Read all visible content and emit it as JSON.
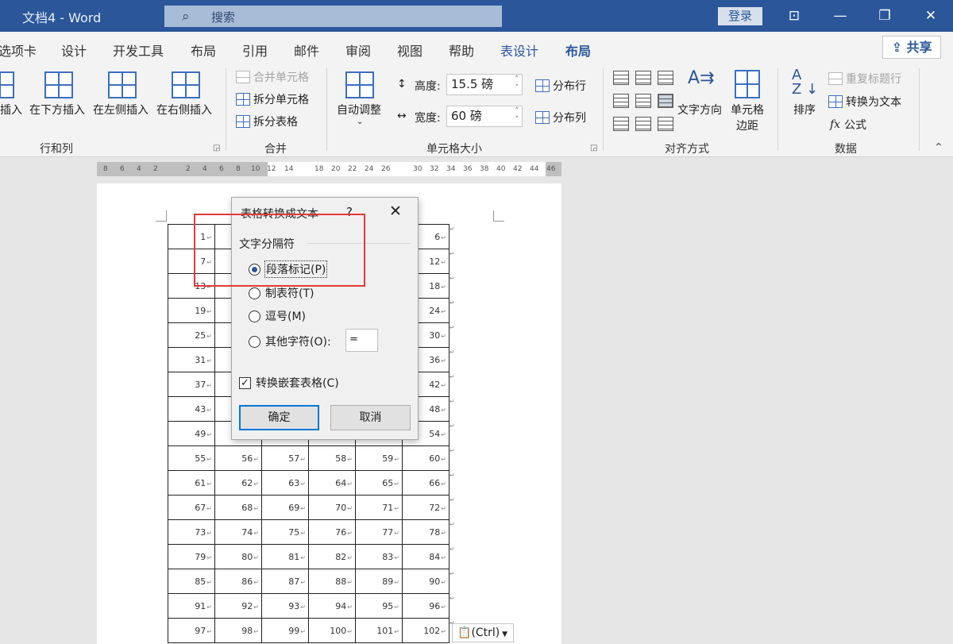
{
  "titlebar": {
    "title": "文档4  -  Word",
    "search_placeholder": "搜索",
    "login": "登录"
  },
  "tabs": [
    {
      "label": "选项卡"
    },
    {
      "label": "设计"
    },
    {
      "label": "开发工具"
    },
    {
      "label": "布局"
    },
    {
      "label": "引用"
    },
    {
      "label": "邮件"
    },
    {
      "label": "审阅"
    },
    {
      "label": "视图"
    },
    {
      "label": "帮助"
    },
    {
      "label": "表设计"
    },
    {
      "label": "布局"
    }
  ],
  "share": "共享",
  "ribbon": {
    "rows_cols": {
      "insert": "插入",
      "insert_below": "在下方插入",
      "insert_left": "在左侧插入",
      "insert_right": "在右侧插入",
      "label": "行和列"
    },
    "merge": {
      "merge_cells": "合并单元格",
      "split_cells": "拆分单元格",
      "split_table": "拆分表格",
      "label": "合并"
    },
    "cell_size": {
      "autofit": "自动调整",
      "height_label": "高度:",
      "height_value": "15.5 磅",
      "width_label": "宽度:",
      "width_value": "60 磅",
      "dist_rows": "分布行",
      "dist_cols": "分布列",
      "label": "单元格大小"
    },
    "alignment": {
      "text_direction": "文字方向",
      "cell_margins_1": "单元格",
      "cell_margins_2": "边距",
      "label": "对齐方式"
    },
    "data": {
      "sort": "排序",
      "repeat_header": "重复标题行",
      "convert_text": "转换为文本",
      "formula": "公式",
      "label": "数据"
    }
  },
  "ruler": [
    "8",
    "6",
    "4",
    "2",
    "2",
    "4",
    "6",
    "8",
    "10",
    "12",
    "14",
    "18",
    "20",
    "22",
    "24",
    "26",
    "30",
    "32",
    "34",
    "36",
    "38",
    "40",
    "42",
    "44",
    "46"
  ],
  "dialog": {
    "title": "表格转换成文本",
    "help": "?",
    "separator_group": "文字分隔符",
    "options": [
      {
        "label": "段落标记(P)",
        "selected": true
      },
      {
        "label": "制表符(T)",
        "selected": false
      },
      {
        "label": "逗号(M)",
        "selected": false
      },
      {
        "label": "其他字符(O):",
        "selected": false
      }
    ],
    "other_char": "=",
    "nested_label": "转换嵌套表格(C)",
    "nested_checked": true,
    "ok": "确定",
    "cancel": "取消"
  },
  "table": {
    "rows": [
      [
        "1",
        "",
        "",
        "",
        "",
        "6"
      ],
      [
        "7",
        "",
        "",
        "",
        "",
        "12"
      ],
      [
        "13",
        "",
        "",
        "",
        "",
        "18"
      ],
      [
        "19",
        "",
        "",
        "",
        "",
        "24"
      ],
      [
        "25",
        "",
        "",
        "",
        "",
        "30"
      ],
      [
        "31",
        "",
        "",
        "",
        "",
        "36"
      ],
      [
        "37",
        "",
        "",
        "",
        "",
        "42"
      ],
      [
        "43",
        "",
        "",
        "",
        "",
        "48"
      ],
      [
        "49",
        "",
        "",
        "",
        "",
        "54"
      ],
      [
        "55",
        "56",
        "57",
        "58",
        "59",
        "60"
      ],
      [
        "61",
        "62",
        "63",
        "64",
        "65",
        "66"
      ],
      [
        "67",
        "68",
        "69",
        "70",
        "71",
        "72"
      ],
      [
        "73",
        "74",
        "75",
        "76",
        "77",
        "78"
      ],
      [
        "79",
        "80",
        "81",
        "82",
        "83",
        "84"
      ],
      [
        "85",
        "86",
        "87",
        "88",
        "89",
        "90"
      ],
      [
        "91",
        "92",
        "93",
        "94",
        "95",
        "96"
      ],
      [
        "97",
        "98",
        "99",
        "100",
        "101",
        "102"
      ]
    ]
  },
  "paste_options": "(Ctrl)"
}
